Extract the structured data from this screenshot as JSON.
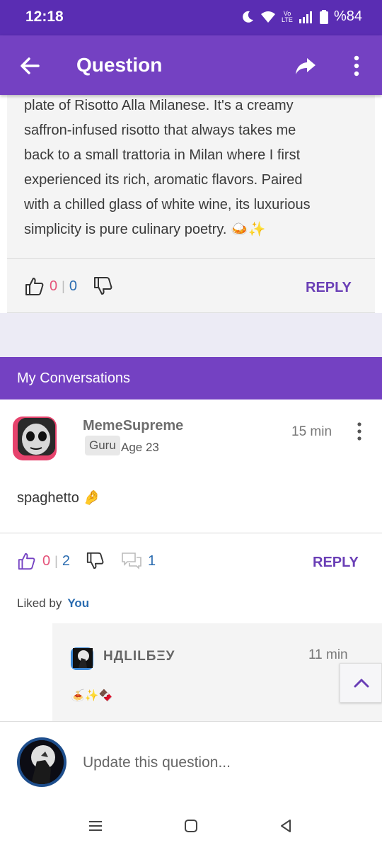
{
  "status_bar": {
    "time": "12:18",
    "network_label": "Vo LTE",
    "battery": "%84"
  },
  "app_bar": {
    "title": "Question"
  },
  "answer": {
    "lines": [
      "plate of Risotto Alla Milanese. It's a creamy",
      "saffron-infused risotto that always takes me",
      "back to a small trattoria in Milan where I first",
      "experienced its rich, aromatic flavors. Paired",
      "with a chilled glass of white wine, its luxurious",
      "simplicity is pure culinary poetry. 🍛✨"
    ],
    "up_count": "0",
    "down_count": "0",
    "reply_label": "REPLY"
  },
  "conversations": {
    "title": "My Conversations"
  },
  "comment": {
    "username": "MemeSupreme",
    "badge": "Guru",
    "age": "Age 23",
    "time": "15 min",
    "text": "spaghetto 🤌",
    "up_count": "0",
    "down_count": "2",
    "comment_count": "1",
    "reply_label": "REPLY",
    "liked_by_label": "Liked by",
    "liked_by_user": "You"
  },
  "nested_reply": {
    "username": "НДLILБΞУ",
    "time": "11 min",
    "text": "🍝✨🍫"
  },
  "input": {
    "placeholder": "Update this question..."
  },
  "colors": {
    "primary": "#7441c2",
    "status": "#5a2db3",
    "accent_pink": "#e5537a",
    "accent_blue": "#2b6cb0"
  }
}
